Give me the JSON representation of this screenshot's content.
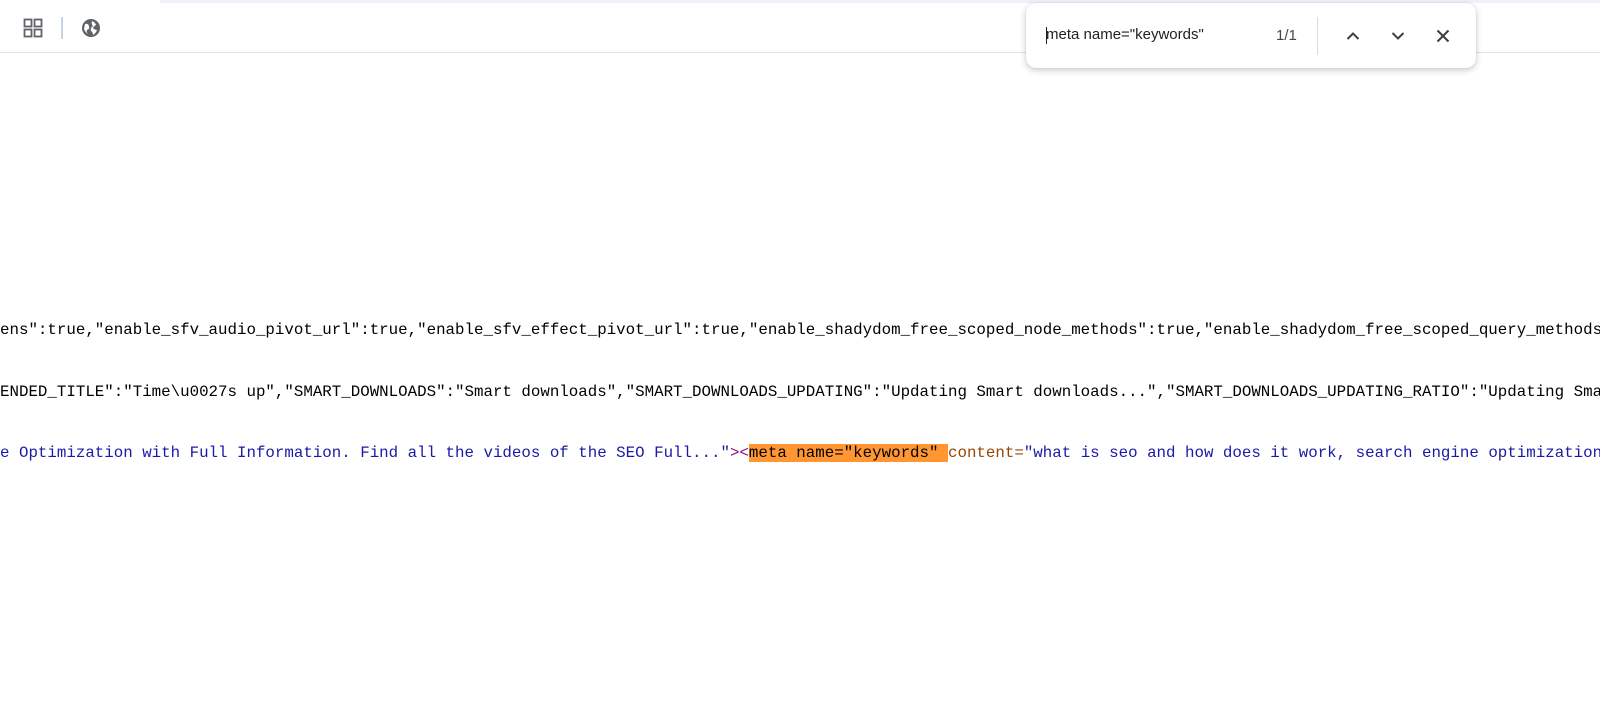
{
  "toolbar": {
    "apps_icon": "apps-grid-icon",
    "site_icon": "globe-icon"
  },
  "find_bar": {
    "query": "meta name=\"keywords\"",
    "match_count": "1/1",
    "prev_icon": "chevron-up-icon",
    "next_icon": "chevron-down-icon",
    "close_icon": "close-icon"
  },
  "source": {
    "line1": "ens\":true,\"enable_sfv_audio_pivot_url\":true,\"enable_sfv_effect_pivot_url\":true,\"enable_shadydom_free_scoped_node_methods\":true,\"enable_shadydom_free_scoped_query_methods\":true,",
    "line2": "ENDED_TITLE\":\"Time\\u0027s up\",\"SMART_DOWNLOADS\":\"Smart downloads\",\"SMART_DOWNLOADS_UPDATING\":\"Updating Smart downloads...\",\"SMART_DOWNLOADS_UPDATING_RATIO\":\"Updating Smart down",
    "line3_value": "e Optimization with Full Information. Find all the videos of the SEO Full...\"",
    "line3_tag_open": "><",
    "line3_match": "meta name=\"keywords\"",
    "line3_space": " ",
    "line3_attr": "content=",
    "line3_rest": "\"what is seo and how does it work, search engine optimization, what"
  },
  "colors": {
    "highlight": "#ff9632",
    "attr_value": "#1a1aa6",
    "attr_name": "#994500",
    "tag": "#881280"
  }
}
